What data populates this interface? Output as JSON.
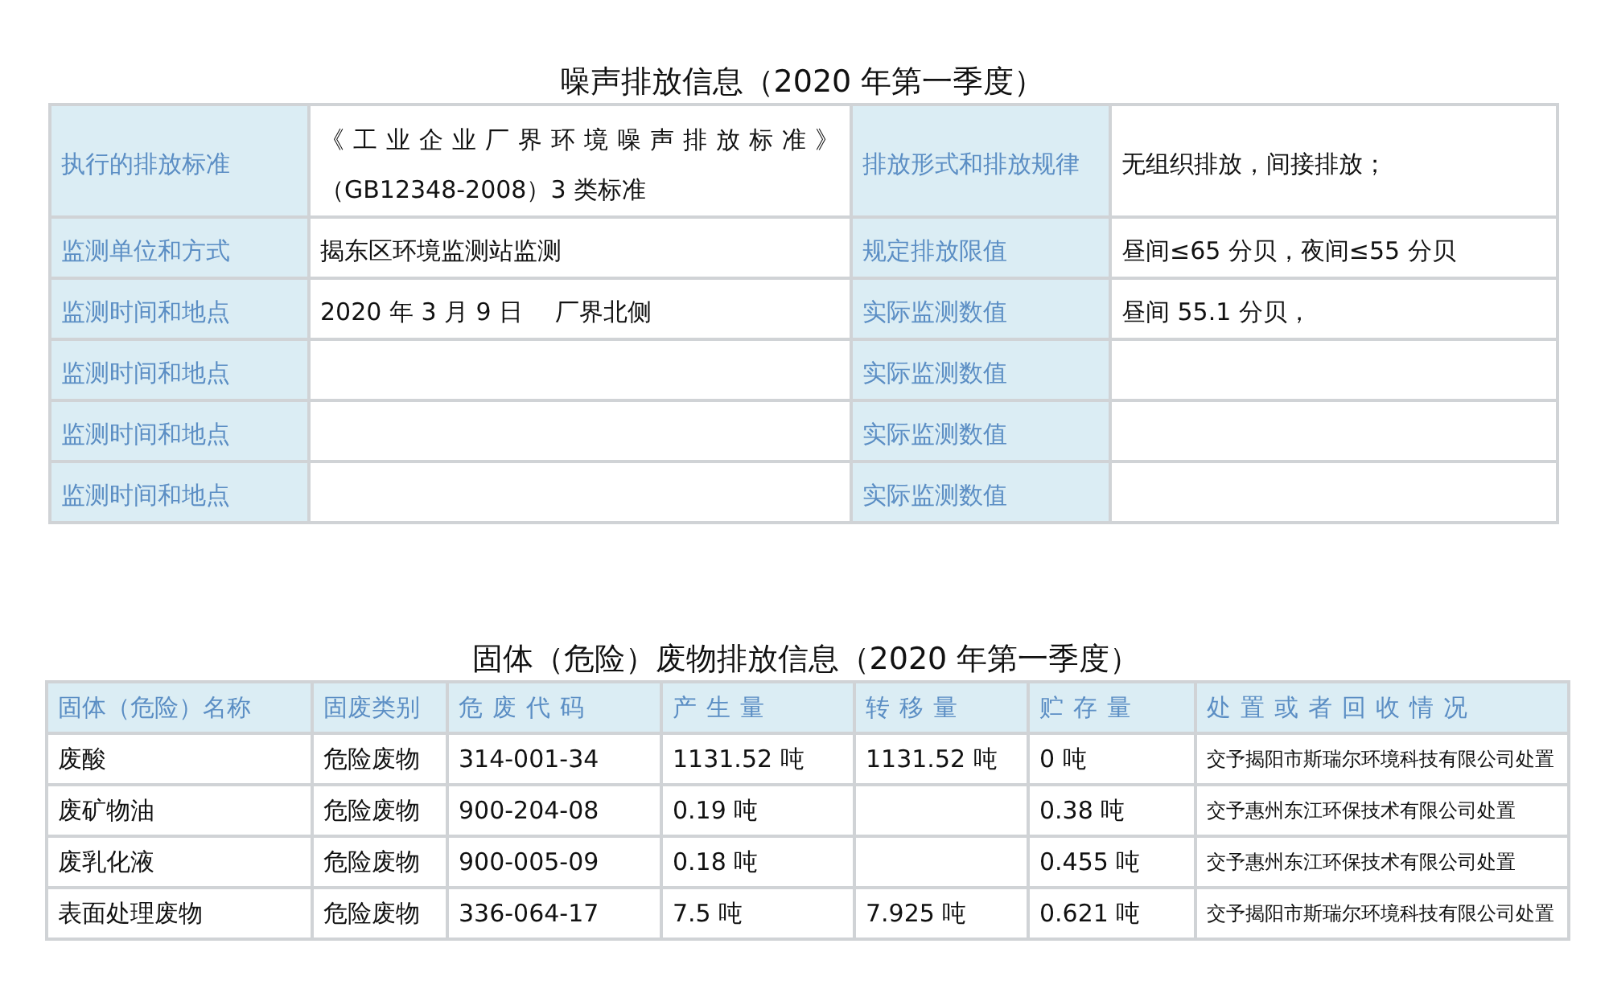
{
  "noise": {
    "title": "噪声排放信息（2020 年第一季度）",
    "rows": [
      {
        "label": "执行的排放标准",
        "value": [
          "《工业企业厂界环境噪声排放标准》",
          "（GB12348-2008）3 类标准"
        ],
        "label2": "排放形式和排放规律",
        "value2": "无组织排放，间接排放；"
      },
      {
        "label": "监测单位和方式",
        "value": [
          "揭东区环境监测站监测"
        ],
        "label2": "规定排放限值",
        "value2": "昼间≤65 分贝，夜间≤55 分贝"
      },
      {
        "label": "监测时间和地点",
        "value": [
          "2020 年 3 月 9 日　  厂界北侧"
        ],
        "label2": "实际监测数值",
        "value2": "昼间 55.1 分贝，"
      },
      {
        "label": "监测时间和地点",
        "value": [],
        "label2": "实际监测数值"
      },
      {
        "label": "监测时间和地点",
        "value": [],
        "label2": "实际监测数值"
      },
      {
        "label": "监测时间和地点",
        "value": [],
        "label2": "实际监测数值"
      }
    ]
  },
  "waste": {
    "title": "固体（危险）废物排放信息（2020 年第一季度）",
    "columns": [
      "固体（危险）名称",
      "固废类别",
      "危废代码",
      "产生量",
      "转移量",
      "贮存量",
      "处置或者回收情况"
    ],
    "rows": [
      [
        "废酸",
        "危险废物",
        "314-001-34",
        "1131.52 吨",
        "1131.52 吨",
        "0 吨",
        "交予揭阳市斯瑞尔环境科技有限公司处置"
      ],
      [
        "废矿物油",
        "危险废物",
        "900-204-08",
        "0.19 吨",
        "",
        "0.38 吨",
        "交予惠州东江环保技术有限公司处置"
      ],
      [
        "废乳化液",
        "危险废物",
        "900-005-09",
        "0.18 吨",
        "",
        "0.455 吨",
        "交予惠州东江环保技术有限公司处置"
      ],
      [
        "表面处理废物",
        "危险废物",
        "336-064-17",
        "7.5 吨",
        "7.925 吨",
        "0.621 吨",
        "交予揭阳市斯瑞尔环境科技有限公司处置"
      ]
    ]
  }
}
